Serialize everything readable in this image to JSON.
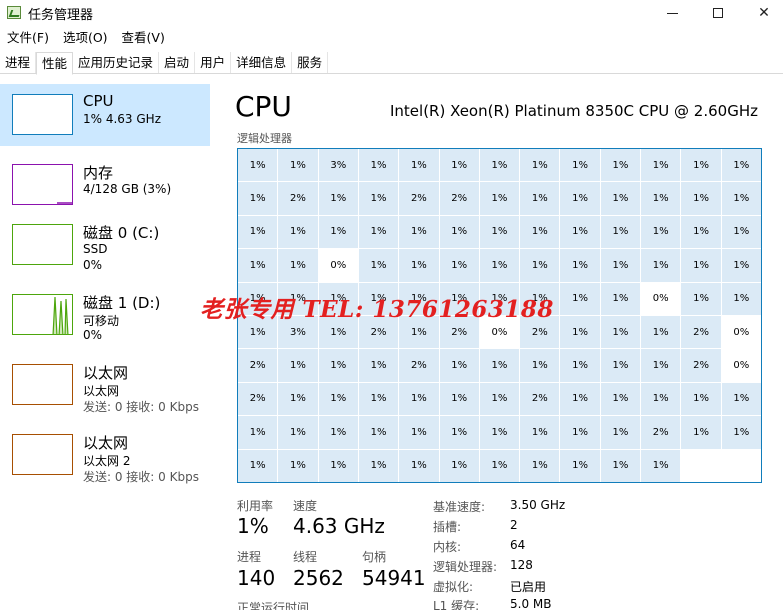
{
  "window": {
    "title": "任务管理器",
    "min_label": "",
    "max_label": "",
    "close_label": "✕"
  },
  "menu": [
    "文件(F)",
    "选项(O)",
    "查看(V)"
  ],
  "tabs": [
    "进程",
    "性能",
    "应用历史记录",
    "启动",
    "用户",
    "详细信息",
    "服务"
  ],
  "active_tab": "性能",
  "sidebar": {
    "items": [
      {
        "name": "CPU",
        "sub1": "1% 4.63 GHz",
        "sub2": "",
        "sub3": "",
        "kind": "cpu"
      },
      {
        "name": "内存",
        "sub1": "4/128 GB (3%)",
        "sub2": "",
        "sub3": "",
        "kind": "mem"
      },
      {
        "name": "磁盘 0 (C:)",
        "sub1": "SSD",
        "sub2": "0%",
        "sub3": "",
        "kind": "disk"
      },
      {
        "name": "磁盘 1 (D:)",
        "sub1": "可移动",
        "sub2": "0%",
        "sub3": "",
        "kind": "disk"
      },
      {
        "name": "以太网",
        "sub1": "以太网",
        "sub2": "发送: 0 接收: 0 Kbps",
        "sub3": "",
        "kind": "net"
      },
      {
        "name": "以太网",
        "sub1": "以太网 2",
        "sub2": "发送: 0 接收: 0 Kbps",
        "sub3": "",
        "kind": "net"
      }
    ]
  },
  "main": {
    "title": "CPU",
    "model": "Intel(R) Xeon(R) Platinum 8350C CPU @ 2.60GHz",
    "grid_label": "逻辑处理器",
    "cores": [
      [
        "1%",
        "1%",
        "3%",
        "1%",
        "1%",
        "1%",
        "1%",
        "1%",
        "1%",
        "1%",
        "1%",
        "1%",
        "1%"
      ],
      [
        "1%",
        "2%",
        "1%",
        "1%",
        "2%",
        "2%",
        "1%",
        "1%",
        "1%",
        "1%",
        "1%",
        "1%",
        "1%"
      ],
      [
        "1%",
        "1%",
        "1%",
        "1%",
        "1%",
        "1%",
        "1%",
        "1%",
        "1%",
        "1%",
        "1%",
        "1%",
        "1%"
      ],
      [
        "1%",
        "1%",
        "0%",
        "1%",
        "1%",
        "1%",
        "1%",
        "1%",
        "1%",
        "1%",
        "1%",
        "1%",
        "1%"
      ],
      [
        "1%",
        "1%",
        "1%",
        "1%",
        "1%",
        "1%",
        "1%",
        "1%",
        "1%",
        "1%",
        "0%",
        "1%",
        "1%"
      ],
      [
        "1%",
        "3%",
        "1%",
        "2%",
        "1%",
        "2%",
        "0%",
        "2%",
        "1%",
        "1%",
        "1%",
        "2%",
        "0%"
      ],
      [
        "2%",
        "1%",
        "1%",
        "1%",
        "2%",
        "1%",
        "1%",
        "1%",
        "1%",
        "1%",
        "1%",
        "2%",
        "0%"
      ],
      [
        "2%",
        "1%",
        "1%",
        "1%",
        "1%",
        "1%",
        "1%",
        "2%",
        "1%",
        "1%",
        "1%",
        "1%",
        "1%"
      ],
      [
        "1%",
        "1%",
        "1%",
        "1%",
        "1%",
        "1%",
        "1%",
        "1%",
        "1%",
        "1%",
        "2%",
        "1%",
        "1%"
      ],
      [
        "1%",
        "1%",
        "1%",
        "1%",
        "1%",
        "1%",
        "1%",
        "1%",
        "1%",
        "1%",
        "1%",
        "",
        ""
      ]
    ],
    "stats": {
      "utilization_label": "利用率",
      "utilization_value": "1%",
      "speed_label": "速度",
      "speed_value": "4.63 GHz",
      "processes_label": "进程",
      "processes_value": "140",
      "threads_label": "线程",
      "threads_value": "2562",
      "handles_label": "句柄",
      "handles_value": "54941",
      "uptime_label": "正常运行时间"
    },
    "info": [
      {
        "label": "基准速度:",
        "value": "3.50 GHz"
      },
      {
        "label": "插槽:",
        "value": "2"
      },
      {
        "label": "内核:",
        "value": "64"
      },
      {
        "label": "逻辑处理器:",
        "value": "128"
      },
      {
        "label": "虚拟化:",
        "value": "已启用"
      },
      {
        "label": "L1 缓存:",
        "value": "5.0 MB"
      }
    ]
  },
  "watermark": "老张专用 TEL: 13761263188",
  "colors": {
    "cpu": "#117dbb",
    "memory": "#8b12ae",
    "disk": "#4da60c",
    "network": "#a74f01",
    "selected": "#cce8ff",
    "cell": "#dbeaf6",
    "watermark": "#e32020"
  }
}
